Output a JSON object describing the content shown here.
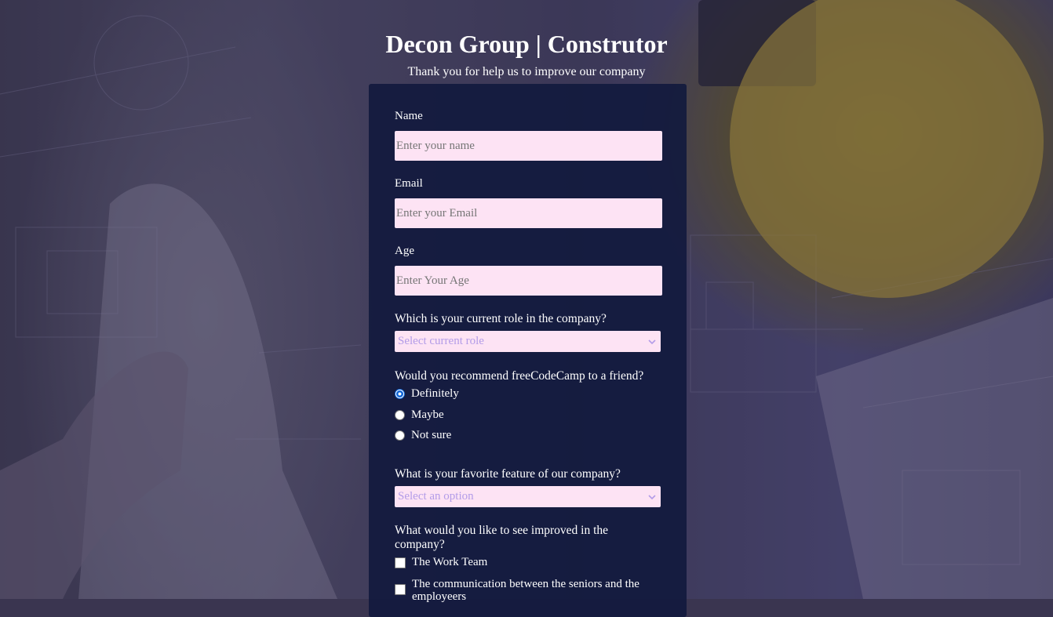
{
  "header": {
    "title": "Decon Group | Construtor",
    "subtitle": "Thank you for help us to improve our company"
  },
  "form": {
    "name": {
      "label": "Name",
      "placeholder": "Enter your name"
    },
    "email": {
      "label": "Email",
      "placeholder": "Enter your Email"
    },
    "age": {
      "label": "Age",
      "placeholder": "Enter Your Age"
    },
    "role": {
      "question": "Which is your current role in the company?",
      "selected": "Select current role"
    },
    "recommend": {
      "question": "Would you recommend freeCodeCamp to a friend?",
      "options": [
        "Definitely",
        "Maybe",
        "Not sure"
      ],
      "checked": "Definitely"
    },
    "feature": {
      "question": "What is your favorite feature of our company?",
      "selected": "Select an option"
    },
    "improve": {
      "question": "What would you like to see improved in the company?",
      "options": [
        "The Work Team",
        "The communication between the seniors and the employeers"
      ]
    }
  },
  "colors": {
    "card": "#10183c",
    "input_bg": "#fde3f4",
    "select_text": "#b39ce8",
    "radio_checked": "#0b62d6"
  },
  "icons": {
    "select_arrow": "chevron-down-icon"
  }
}
